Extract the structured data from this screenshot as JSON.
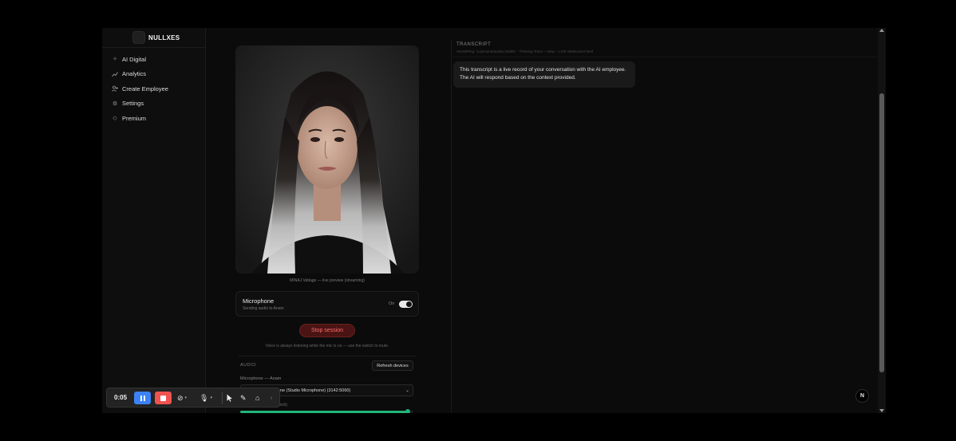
{
  "brand": {
    "name": "NULLXES"
  },
  "sidebar": {
    "items": [
      {
        "label": "AI Digital",
        "icon": "sparkle-icon"
      },
      {
        "label": "Analytics",
        "icon": "chart-line-icon"
      },
      {
        "label": "Create Employee",
        "icon": "user-plus-icon"
      },
      {
        "label": "Settings",
        "icon": "gear-icon"
      },
      {
        "label": "Premium",
        "icon": "diamond-icon"
      }
    ]
  },
  "preview": {
    "caption": "MINAJ Vattage — live preview (streaming)"
  },
  "microphone": {
    "title": "Microphone",
    "subtitle": "Sending audio to Anam",
    "state": "On",
    "enabled": true
  },
  "session": {
    "stop_label": "Stop session",
    "hint": "Voice is always listening while the mic is on — use the switch to mute."
  },
  "audio": {
    "section_label": "AUDIO",
    "refresh_label": "Refresh devices",
    "mic_select_label": "Microphone — Anam",
    "mic_select_value": "Default - Microphone (Studio Microphone) (3142:5060)",
    "level_label": "Input level (avatar speech)",
    "level": 0.97
  },
  "transcript": {
    "title": "TRANSCRIPT",
    "subtitle": "ANAMPing: 'a persona/avatar (stable' · Thinking Trace – relay – LIVE Websocket feed",
    "message": "This transcript is a live record of your conversation with the AI employee. The AI will respond based on the context provided."
  },
  "recorder": {
    "time": "0:05",
    "colors": {
      "pause": "#3b82f6",
      "stop": "#ef5350"
    }
  },
  "badge": {
    "letter": "N"
  },
  "colors": {
    "accent_green": "#21b57a",
    "danger": "#ef5350"
  }
}
